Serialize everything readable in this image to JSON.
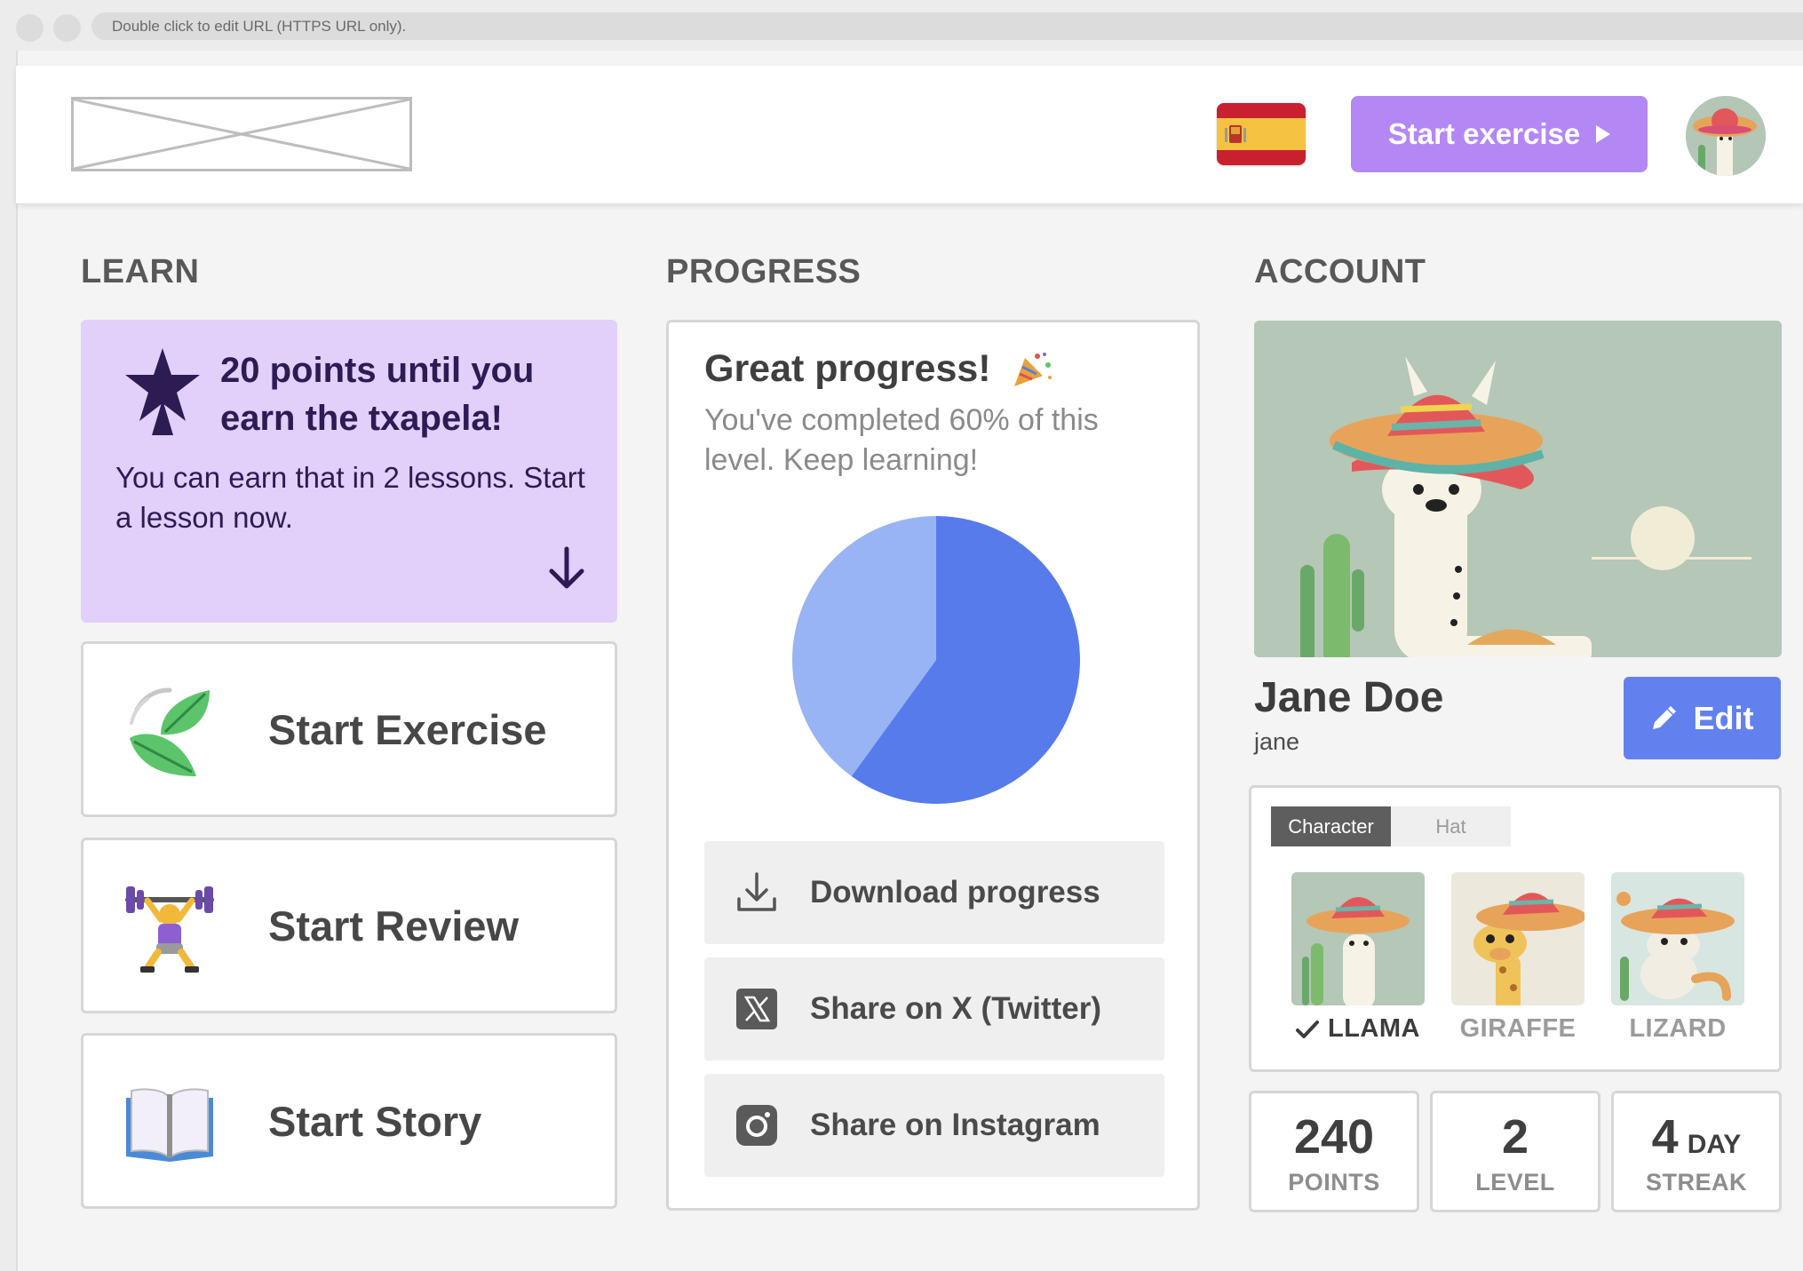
{
  "browser": {
    "url_placeholder": "Double click to edit URL (HTTPS URL only)."
  },
  "header": {
    "start_button_label": "Start exercise",
    "flag_icon": "spain-flag-icon",
    "avatar_icon": "llama-avatar-icon"
  },
  "sections": {
    "learn": "LEARN",
    "progress": "PROGRESS",
    "account": "ACCOUNT"
  },
  "learn": {
    "promo_title": "20 points until you earn the txapela!",
    "promo_text": "You can earn that in 2 lessons. Start a lesson now.",
    "cards": [
      {
        "label": "Start Exercise",
        "icon": "leaves-icon"
      },
      {
        "label": "Start Review",
        "icon": "weightlifter-icon"
      },
      {
        "label": "Start Story",
        "icon": "open-book-icon"
      }
    ]
  },
  "progress": {
    "title": "Great progress!",
    "subtitle": "You've completed 60% of this level. Keep learning!",
    "completed_fraction": 0.6,
    "colors": {
      "completed": "#587bec",
      "remaining": "#98b4f4"
    },
    "actions": [
      {
        "label": "Download progress",
        "icon": "download-icon"
      },
      {
        "label": "Share on X (Twitter)",
        "icon": "x-logo-icon"
      },
      {
        "label": "Share on Instagram",
        "icon": "instagram-icon"
      }
    ]
  },
  "account": {
    "name": "Jane Doe",
    "username": "jane",
    "edit_label": "Edit",
    "tabs": [
      {
        "label": "Character",
        "active": true
      },
      {
        "label": "Hat",
        "active": false
      }
    ],
    "characters": [
      {
        "name": "LLAMA",
        "selected": true
      },
      {
        "name": "GIRAFFE",
        "selected": false
      },
      {
        "name": "LIZARD",
        "selected": false
      }
    ],
    "stats": [
      {
        "value": "240",
        "suffix": "",
        "caption": "POINTS"
      },
      {
        "value": "2",
        "suffix": "",
        "caption": "LEVEL"
      },
      {
        "value": "4",
        "suffix": "DAY",
        "caption": "STREAK"
      }
    ]
  },
  "colors": {
    "accent": "#b388f5",
    "edit": "#6281ef",
    "promo_bg": "#e2cffa"
  }
}
